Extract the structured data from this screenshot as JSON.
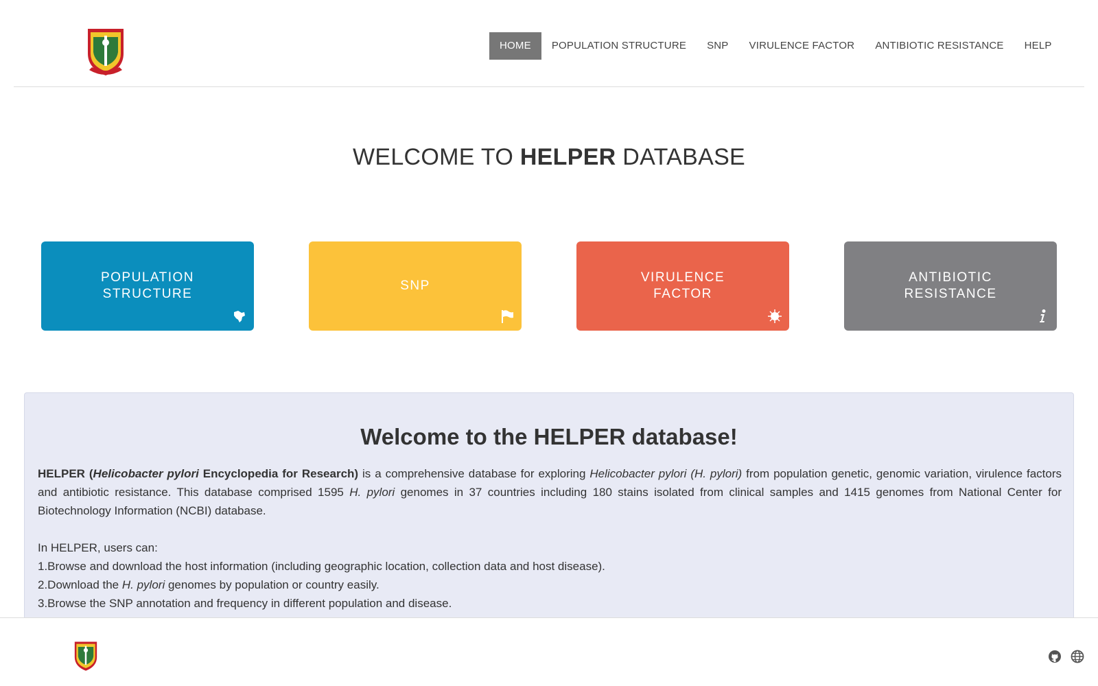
{
  "nav": {
    "items": [
      "HOME",
      "POPULATION STRUCTURE",
      "SNP",
      "VIRULENCE FACTOR",
      "ANTIBIOTIC RESISTANCE",
      "HELP"
    ],
    "active": "HOME"
  },
  "hero": {
    "prefix": "WELCOME TO ",
    "brand": "HELPER",
    "suffix": " DATABASE"
  },
  "tiles": [
    {
      "label": "POPULATION\nSTRUCTURE",
      "icon": "map-icon",
      "color": "#0b8ebd"
    },
    {
      "label": "SNP",
      "icon": "flag-icon",
      "color": "#fcc23a"
    },
    {
      "label": "VIRULENCE\nFACTOR",
      "icon": "bacteria-icon",
      "color": "#ea644b"
    },
    {
      "label": "ANTIBIOTIC\nRESISTANCE",
      "icon": "info-icon",
      "color": "#808083"
    }
  ],
  "panel": {
    "title": "Welcome to the HELPER database!",
    "intro": {
      "name": "HELPER (",
      "name_italic": "Helicobacter pylori",
      "name_rest": " Encyclopedia for Research)",
      "t1": " is a comprehensive database for exploring ",
      "species": "Helicobacter pylori (H. pylori)",
      "t2": " from population genetic, genomic variation, virulence factors and antibiotic resistance. This database comprised 1595 ",
      "short": "H. pylori",
      "t3": " genomes in 37 countries including 180 stains isolated from clinical samples and 1415 genomes from National Center for Biotechnology Information (NCBI) database."
    },
    "users_can": "In HELPER, users can:",
    "item1": "1.Browse and download the host information (including geographic location, collection data and host disease).",
    "item2_a": "2.Download the ",
    "item2_b": "H. pylori",
    "item2_c": " genomes by population or country easily.",
    "item3": "3.Browse the SNP annotation and frequency in different population and disease."
  },
  "footer": {
    "icons": [
      "github-icon",
      "globe-icon"
    ]
  }
}
